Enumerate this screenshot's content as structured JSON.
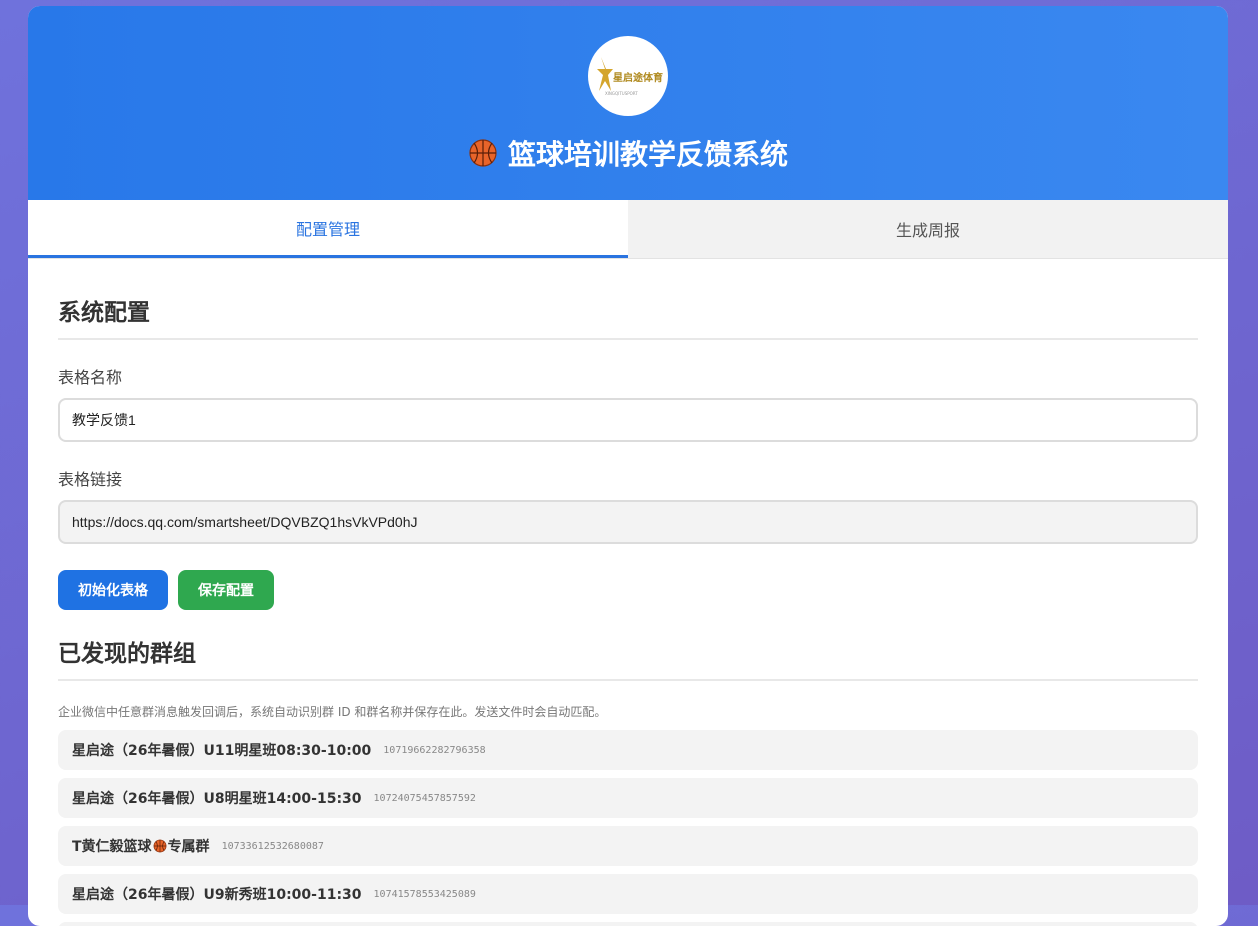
{
  "header": {
    "logo_text": "星启途体育",
    "logo_subtext": "XINGQITUSPORT",
    "title": "篮球培训教学反馈系统",
    "title_icon": "basketball-icon"
  },
  "tabs": [
    {
      "label": "配置管理",
      "active": true
    },
    {
      "label": "生成周报",
      "active": false
    }
  ],
  "config": {
    "section_title": "系统配置",
    "sheet_name_label": "表格名称",
    "sheet_name_value": "教学反馈1",
    "sheet_link_label": "表格链接",
    "sheet_link_value": "https://docs.qq.com/smartsheet/DQVBZQ1hsVkVPd0hJ",
    "init_button": "初始化表格",
    "save_button": "保存配置"
  },
  "groups": {
    "section_title": "已发现的群组",
    "hint": "企业微信中任意群消息触发回调后，系统自动识别群 ID 和群名称并保存在此。发送文件时会自动匹配。",
    "items": [
      {
        "name": "星启途（26年暑假）U11明星班08:30-10:00",
        "id": "10719662282796358"
      },
      {
        "name": "星启途（26年暑假）U8明星班14:00-15:30",
        "id": "10724075457857592"
      },
      {
        "name_prefix": "T黄仁毅篮球",
        "name_suffix": "专属群",
        "id": "10733612532680087",
        "has_icon": true
      },
      {
        "name": "星启途（26年暑假）U9新秀班10:00-11:30",
        "id": "10741578553425089"
      }
    ]
  },
  "colors": {
    "header_blue": "#2878e9",
    "accent_blue": "#2a74e0",
    "button_blue": "#1f72e3",
    "button_green": "#2fa84f",
    "logo_gold": "#d4a52c"
  }
}
